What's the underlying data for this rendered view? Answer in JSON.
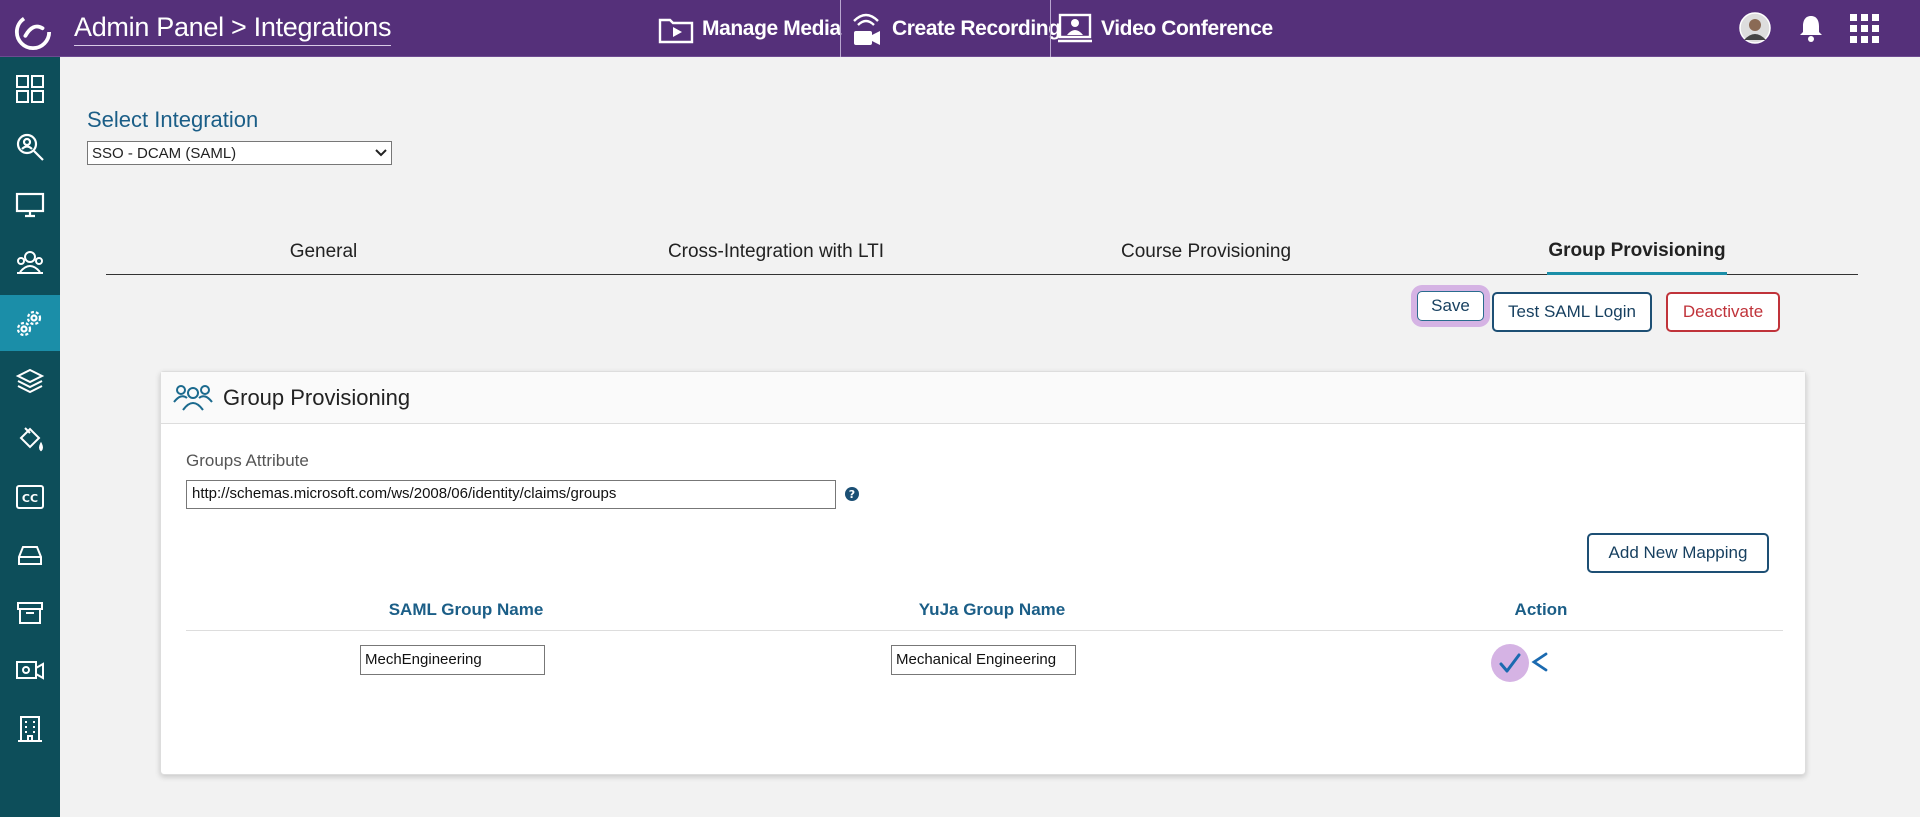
{
  "header": {
    "breadcrumb": "Admin Panel > Integrations",
    "nav": [
      {
        "label": "Manage Media",
        "icon": "media-folder-icon"
      },
      {
        "label": "Create Recording",
        "icon": "recording-icon"
      },
      {
        "label": "Video Conference",
        "icon": "video-conference-icon"
      }
    ],
    "right_icons": [
      "avatar",
      "bell-icon",
      "apps-grid-icon"
    ]
  },
  "sidebar": {
    "items": [
      {
        "icon": "dashboard-icon",
        "active": false
      },
      {
        "icon": "search-icon",
        "active": false
      },
      {
        "icon": "monitor-icon",
        "active": false
      },
      {
        "icon": "group-icon",
        "active": false
      },
      {
        "icon": "settings-gears-icon",
        "active": true
      },
      {
        "icon": "layers-icon",
        "active": false
      },
      {
        "icon": "paint-bucket-icon",
        "active": false
      },
      {
        "icon": "closed-caption-icon",
        "active": false
      },
      {
        "icon": "drive-icon",
        "active": false
      },
      {
        "icon": "archive-icon",
        "active": false
      },
      {
        "icon": "video-camera-icon",
        "active": false
      },
      {
        "icon": "building-icon",
        "active": false
      }
    ]
  },
  "integration": {
    "label": "Select Integration",
    "selected": "SSO - DCAM (SAML)"
  },
  "tabs": [
    {
      "label": "General",
      "active": false
    },
    {
      "label": "Cross-Integration with LTI",
      "active": false
    },
    {
      "label": "Course Provisioning",
      "active": false
    },
    {
      "label": "Group Provisioning",
      "active": true
    }
  ],
  "actions": {
    "save": "Save",
    "test": "Test SAML Login",
    "deactivate": "Deactivate"
  },
  "panel": {
    "title": "Group Provisioning",
    "groups_attribute_label": "Groups Attribute",
    "groups_attribute_value": "http://schemas.microsoft.com/ws/2008/06/identity/claims/groups",
    "add_mapping": "Add New Mapping",
    "columns": [
      "SAML Group Name",
      "YuJa Group Name",
      "Action"
    ],
    "rows": [
      {
        "saml": "MechEngineering",
        "yuja": "Mechanical Engineering"
      }
    ]
  },
  "colors": {
    "topbar": "#55307a",
    "sidebar": "#0d4e5a",
    "sidebar_active": "#1b8ea8",
    "highlight": "#d5b3e4",
    "danger": "#c0333a"
  }
}
